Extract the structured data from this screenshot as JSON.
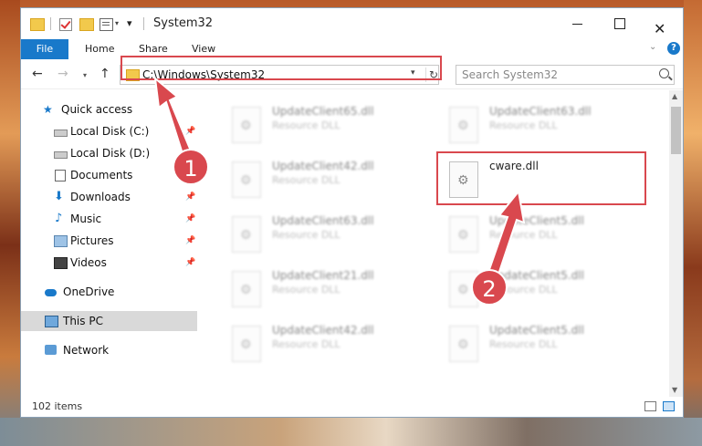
{
  "window": {
    "title": "System32"
  },
  "ribbon": {
    "file": "File",
    "home": "Home",
    "share": "Share",
    "view": "View"
  },
  "address": {
    "path": "C:\\Windows\\System32"
  },
  "search": {
    "placeholder": "Search System32"
  },
  "sidebar": {
    "quick_access": "Quick access",
    "local_c": "Local Disk (C:)",
    "local_d": "Local Disk (D:)",
    "documents": "Documents",
    "downloads": "Downloads",
    "music": "Music",
    "pictures": "Pictures",
    "videos": "Videos",
    "onedrive": "OneDrive",
    "this_pc": "This PC",
    "network": "Network"
  },
  "files": [
    {
      "name": "UpdateClient65.dll",
      "type": "Resource DLL"
    },
    {
      "name": "UpdateClient63.dll",
      "type": "Resource DLL"
    },
    {
      "name": "UpdateClient42.dll",
      "type": "Resource DLL"
    },
    {
      "name": "cware.dll",
      "type": ""
    },
    {
      "name": "UpdateClient63.dll",
      "type": "Resource DLL"
    },
    {
      "name": "UpdateClient5.dll",
      "type": "Resource DLL"
    },
    {
      "name": "UpdateClient21.dll",
      "type": "Resource DLL"
    },
    {
      "name": "UpdateClient5.dll",
      "type": "Resource DLL"
    },
    {
      "name": "UpdateClient42.dll",
      "type": "Resource DLL"
    },
    {
      "name": "UpdateClient5.dll",
      "type": "Resource DLL"
    }
  ],
  "status": {
    "count": "102 items"
  },
  "annotations": {
    "step1": "1",
    "step2": "2",
    "color": "#d9484e"
  }
}
